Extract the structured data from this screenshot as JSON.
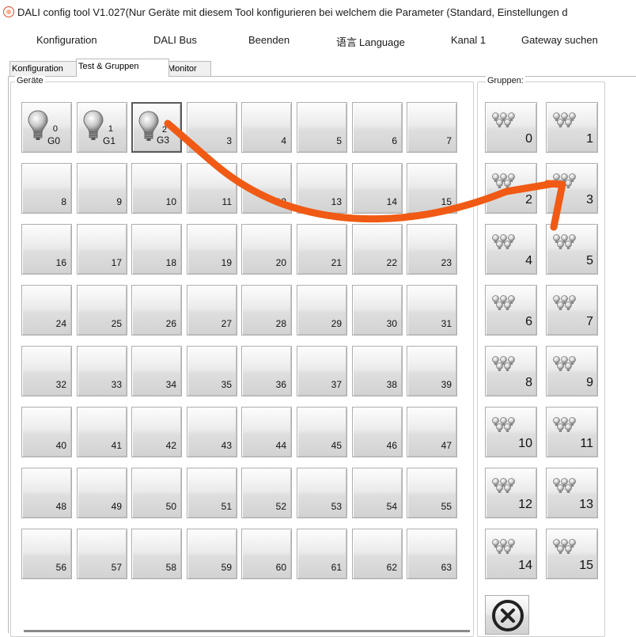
{
  "window": {
    "title": "DALI config tool V1.027(Nur Geräte mit diesem Tool konfigurieren bei welchem die Parameter (Standard, Einstellungen d"
  },
  "menu": {
    "items": [
      "Konfiguration",
      "DALI Bus",
      "Beenden",
      "Language",
      "Kanal 1",
      "Gateway suchen"
    ],
    "language_glyph": "语言"
  },
  "tabs": [
    "Konfiguration",
    "Test & Gruppen",
    "Monitor"
  ],
  "active_tab": "Test & Gruppen",
  "devices": {
    "label": "Geräte",
    "items": [
      {
        "num": "0",
        "group": "G0",
        "icon": "bulb-icon"
      },
      {
        "num": "1",
        "group": "G1",
        "icon": "bulb-icon"
      },
      {
        "num": "2",
        "group": "G3",
        "icon": "bulb-icon"
      },
      {
        "num": "3"
      },
      {
        "num": "4"
      },
      {
        "num": "5"
      },
      {
        "num": "6"
      },
      {
        "num": "7"
      },
      {
        "num": "8"
      },
      {
        "num": "9"
      },
      {
        "num": "10"
      },
      {
        "num": "11"
      },
      {
        "num": "12"
      },
      {
        "num": "13"
      },
      {
        "num": "14"
      },
      {
        "num": "15"
      },
      {
        "num": "16"
      },
      {
        "num": "17"
      },
      {
        "num": "18"
      },
      {
        "num": "19"
      },
      {
        "num": "20"
      },
      {
        "num": "21"
      },
      {
        "num": "22"
      },
      {
        "num": "23"
      },
      {
        "num": "24"
      },
      {
        "num": "25"
      },
      {
        "num": "26"
      },
      {
        "num": "27"
      },
      {
        "num": "28"
      },
      {
        "num": "29"
      },
      {
        "num": "30"
      },
      {
        "num": "31"
      },
      {
        "num": "32"
      },
      {
        "num": "33"
      },
      {
        "num": "34"
      },
      {
        "num": "35"
      },
      {
        "num": "36"
      },
      {
        "num": "37"
      },
      {
        "num": "38"
      },
      {
        "num": "39"
      },
      {
        "num": "40"
      },
      {
        "num": "41"
      },
      {
        "num": "42"
      },
      {
        "num": "43"
      },
      {
        "num": "44"
      },
      {
        "num": "45"
      },
      {
        "num": "46"
      },
      {
        "num": "47"
      },
      {
        "num": "48"
      },
      {
        "num": "49"
      },
      {
        "num": "50"
      },
      {
        "num": "51"
      },
      {
        "num": "52"
      },
      {
        "num": "53"
      },
      {
        "num": "54"
      },
      {
        "num": "55"
      },
      {
        "num": "56"
      },
      {
        "num": "57"
      },
      {
        "num": "58"
      },
      {
        "num": "59"
      },
      {
        "num": "60"
      },
      {
        "num": "61"
      },
      {
        "num": "62"
      },
      {
        "num": "63"
      }
    ]
  },
  "groups": {
    "label": "Gruppen:",
    "items": [
      "0",
      "1",
      "2",
      "3",
      "4",
      "5",
      "6",
      "7",
      "8",
      "9",
      "10",
      "11",
      "12",
      "13",
      "14",
      "15"
    ],
    "icon": "bulb-group-icon"
  },
  "close_button": {
    "icon": "close-circle-icon"
  },
  "annotation": {
    "color": "#f05a14",
    "description_icon": "arrow-annotation"
  }
}
